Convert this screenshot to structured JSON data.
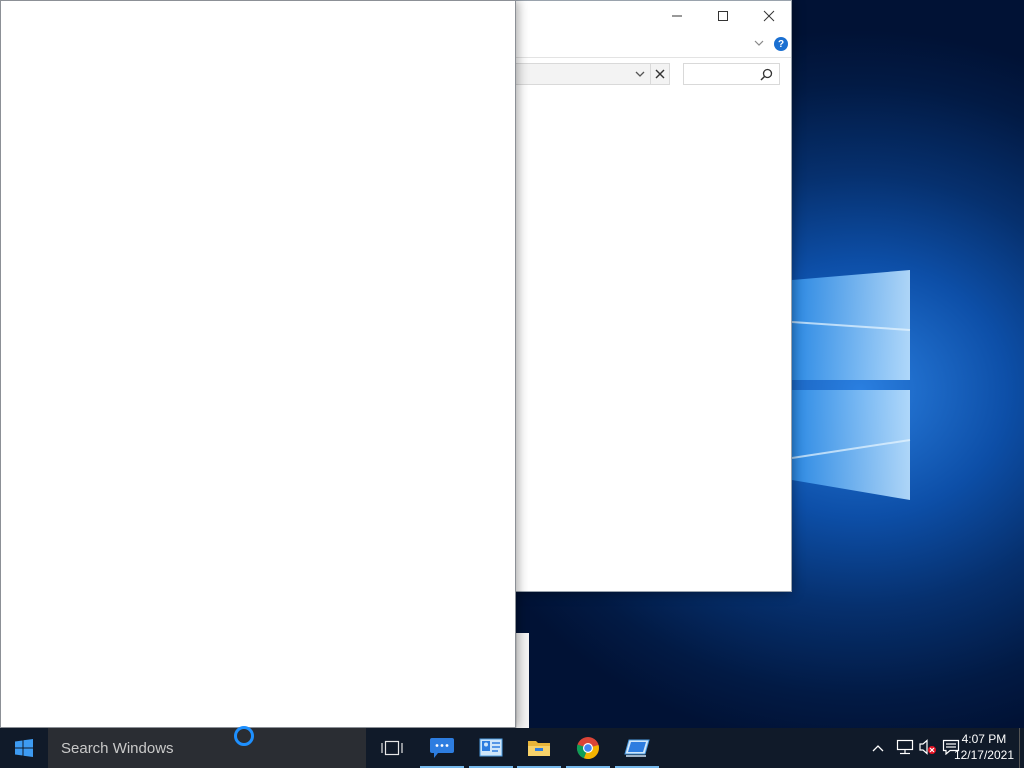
{
  "taskbar": {
    "search_placeholder": "Search Windows",
    "apps": [
      {
        "icon": "task-view-icon"
      },
      {
        "icon": "chat-app-icon"
      },
      {
        "icon": "contacts-app-icon"
      },
      {
        "icon": "file-explorer-icon"
      },
      {
        "icon": "chrome-icon"
      },
      {
        "icon": "remote-desktop-icon"
      }
    ],
    "tray": {
      "show_hidden_icons": "chevron-up-icon",
      "network": "network-icon",
      "volume": "volume-muted-icon",
      "notifications": "action-center-icon"
    },
    "clock": {
      "time": "4:07 PM",
      "date": "12/17/2021"
    }
  },
  "explorer_window": {
    "help_glyph": "?"
  },
  "colors": {
    "accent": "#1e90ff",
    "taskbar": "#101a29",
    "desktop": "#0d4fa8"
  }
}
